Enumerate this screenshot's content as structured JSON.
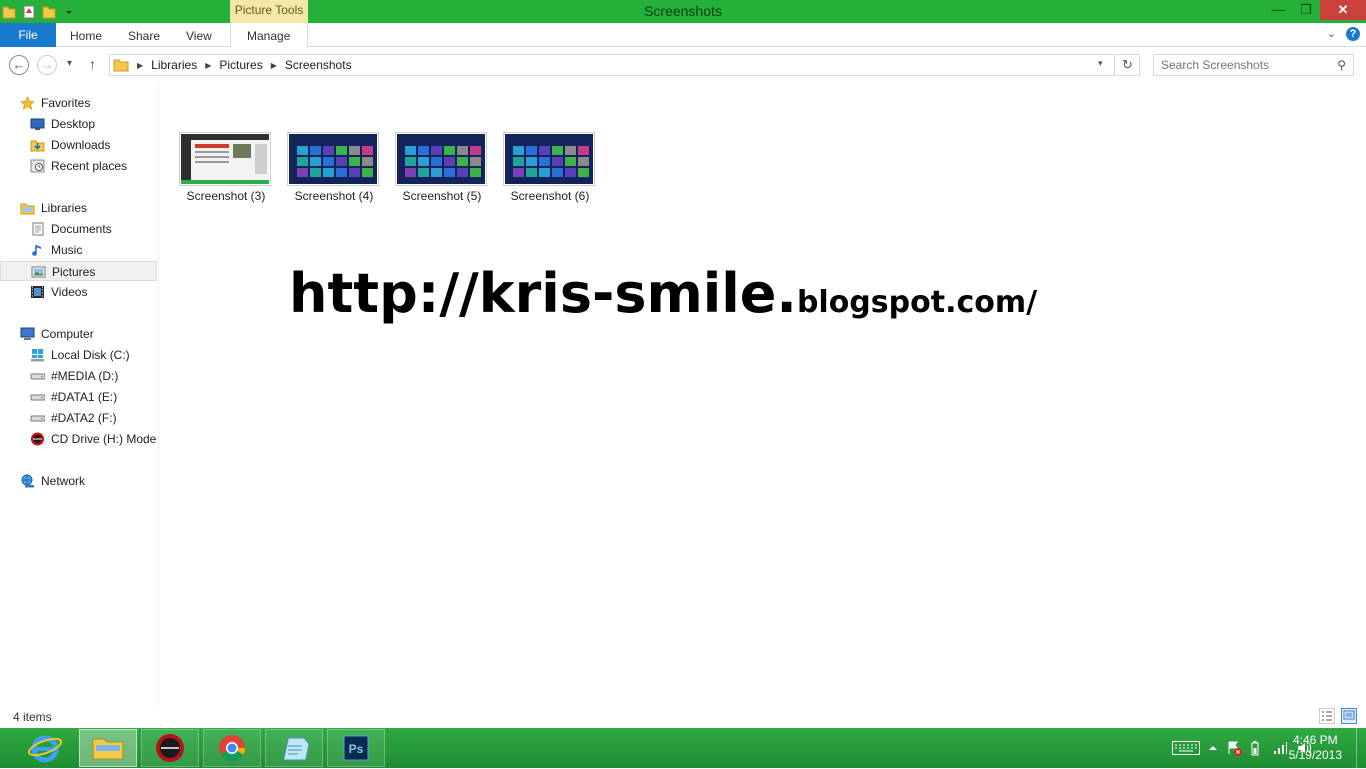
{
  "window": {
    "title": "Screenshots",
    "context_tab": "Picture Tools",
    "minimize": "—",
    "maximize": "❐",
    "close": "✕"
  },
  "ribbon": {
    "tabs": [
      {
        "label": "File"
      },
      {
        "label": "Home"
      },
      {
        "label": "Share"
      },
      {
        "label": "View"
      },
      {
        "label": "Manage"
      }
    ],
    "collapse": "⌄",
    "help": "?"
  },
  "nav": {
    "back": "←",
    "forward": "→",
    "recent": "▾",
    "up": "↑",
    "refresh": "↻",
    "address_dropdown": "▾",
    "breadcrumb": [
      "Libraries",
      "Pictures",
      "Screenshots"
    ],
    "breadcrumb_sep": "▶"
  },
  "search": {
    "placeholder": "Search Screenshots",
    "icon": "⚲"
  },
  "sidebar": {
    "favorites": {
      "label": "Favorites",
      "items": [
        "Desktop",
        "Downloads",
        "Recent places"
      ]
    },
    "libraries": {
      "label": "Libraries",
      "items": [
        "Documents",
        "Music",
        "Pictures",
        "Videos"
      ],
      "selected": "Pictures"
    },
    "computer": {
      "label": "Computer",
      "items": [
        "Local Disk (C:)",
        "#MEDIA (D:)",
        "#DATA1 (E:)",
        "#DATA2 (F:)",
        "CD Drive (H:) Modem"
      ]
    },
    "network": {
      "label": "Network"
    }
  },
  "files": [
    {
      "name": "Screenshot (3)",
      "kind": "webpage"
    },
    {
      "name": "Screenshot (4)",
      "kind": "start"
    },
    {
      "name": "Screenshot (5)",
      "kind": "start"
    },
    {
      "name": "Screenshot (6)",
      "kind": "start"
    }
  ],
  "watermark": {
    "part1": "http://kris-smile.",
    "part2": "blogspot.com/"
  },
  "status": {
    "count": "4 items"
  },
  "taskbar": {
    "apps": [
      "internet-explorer",
      "file-explorer",
      "smartfren",
      "chrome",
      "notepad",
      "photoshop"
    ],
    "time": "4:46 PM",
    "date": "5/19/2013"
  },
  "colors": {
    "titlebar": "#25b03a",
    "file_tab": "#1979ca",
    "taskbar": "#1f8d33",
    "selected_nav": "#f0f0f0"
  }
}
